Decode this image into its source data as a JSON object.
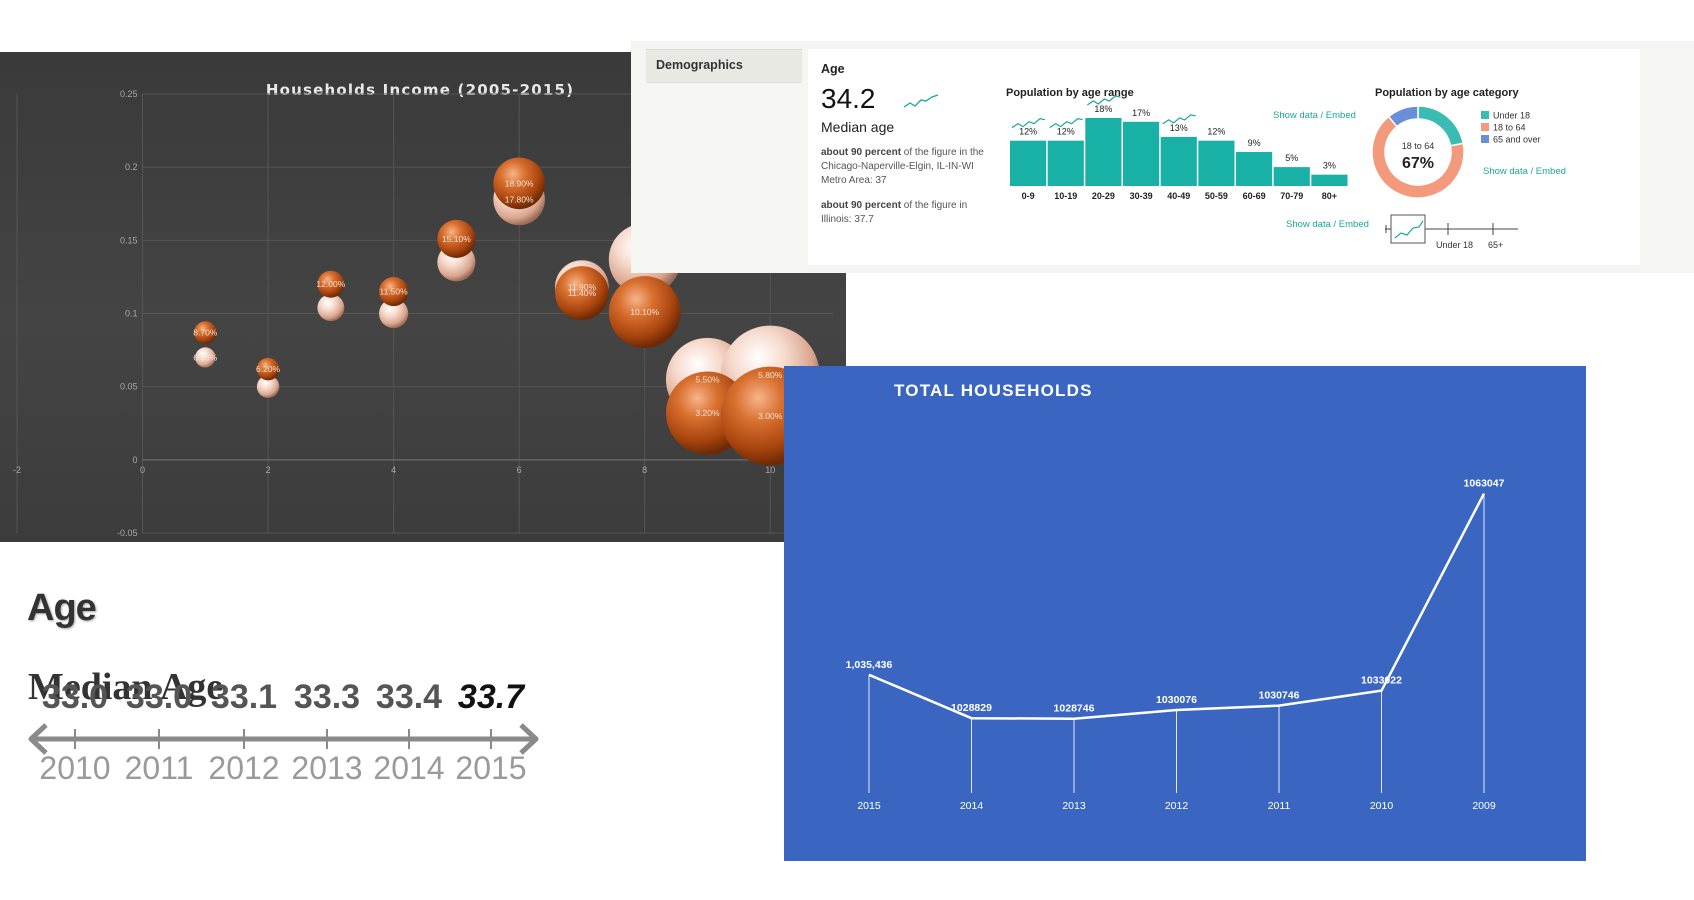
{
  "chart_data": [
    {
      "type": "scatter",
      "subtype": "bubble",
      "title": "Households Income (2005-2015)",
      "xlim": [
        -2,
        11
      ],
      "ylim": [
        -0.05,
        0.25
      ],
      "xticks": [
        "-2",
        "0",
        "2",
        "4",
        "6",
        "8",
        "10"
      ],
      "yticks": [
        "-0.05",
        "0",
        "0.05",
        "0.1",
        "0.15",
        "0.2",
        "0.25"
      ],
      "grid": true,
      "colors": {
        "dark_bubble": "#c2561b",
        "light_bubble": "#f0c8b6",
        "background": "#404040"
      },
      "series": [
        {
          "points": [
            {
              "x": 1,
              "y": 0.087,
              "size": 1.0,
              "label": "8.70%"
            },
            {
              "x": 2,
              "y": 0.062,
              "size": 1.0,
              "label": "6.20%"
            },
            {
              "x": 3,
              "y": 0.12,
              "size": 1.2,
              "label": "12.00%"
            },
            {
              "x": 4,
              "y": 0.115,
              "size": 1.3,
              "label": "11.50%"
            },
            {
              "x": 5,
              "y": 0.151,
              "size": 1.7,
              "label": "15.10%"
            },
            {
              "x": 6,
              "y": 0.189,
              "size": 2.3,
              "label": "18.90%"
            },
            {
              "x": 7,
              "y": 0.114,
              "size": 2.4,
              "label": "11.40%"
            },
            {
              "x": 8,
              "y": 0.101,
              "size": 3.2,
              "label": "10.10%"
            },
            {
              "x": 9,
              "y": 0.032,
              "size": 3.7,
              "label": "3.20%"
            },
            {
              "x": 10,
              "y": 0.03,
              "size": 4.4,
              "label": "3.00%"
            }
          ]
        },
        {
          "points": [
            {
              "x": 1,
              "y": 0.07,
              "size": 0.9,
              "label": "6.90%"
            },
            {
              "x": 2,
              "y": 0.05,
              "size": 1.0,
              "label": ""
            },
            {
              "x": 3,
              "y": 0.104,
              "size": 1.2,
              "label": ""
            },
            {
              "x": 4,
              "y": 0.1,
              "size": 1.3,
              "label": ""
            },
            {
              "x": 5,
              "y": 0.135,
              "size": 1.7,
              "label": ""
            },
            {
              "x": 6,
              "y": 0.178,
              "size": 2.3,
              "label": "17.80%"
            },
            {
              "x": 7,
              "y": 0.118,
              "size": 2.4,
              "label": "11.90%"
            },
            {
              "x": 8,
              "y": 0.137,
              "size": 3.2,
              "label": "13.70%"
            },
            {
              "x": 9,
              "y": 0.055,
              "size": 3.7,
              "label": "5.50%"
            },
            {
              "x": 10,
              "y": 0.058,
              "size": 4.4,
              "label": "5.80%"
            }
          ]
        }
      ]
    },
    {
      "type": "bar",
      "title": "Population by age range",
      "categories": [
        "0-9",
        "10-19",
        "20-29",
        "30-39",
        "40-49",
        "50-59",
        "60-69",
        "70-79",
        "80+"
      ],
      "values": [
        12,
        12,
        18,
        17,
        13,
        12,
        9,
        5,
        3
      ],
      "value_labels": [
        "12%",
        "12%",
        "18%",
        "17%",
        "13%",
        "12%",
        "9%",
        "5%",
        "3%"
      ],
      "color": "#19b0a6",
      "sparkline_categories": [
        "0-9",
        "10-19",
        "20-29",
        "40-49"
      ]
    },
    {
      "type": "pie",
      "subtype": "donut",
      "title": "Population by age category",
      "center_label": "18 to 64",
      "center_value": "67%",
      "slices": [
        {
          "name": "Under 18",
          "value": 22,
          "color": "#3bbcb2"
        },
        {
          "name": "18 to 64",
          "value": 67,
          "color": "#f29a7b"
        },
        {
          "name": "65 and over",
          "value": 11,
          "color": "#6b8fd6"
        }
      ],
      "legend_position": "right"
    },
    {
      "type": "line",
      "title": "TOTAL HOUSEHOLDS",
      "categories": [
        "2015",
        "2014",
        "2013",
        "2012",
        "2011",
        "2010",
        "2009"
      ],
      "values": [
        1035436,
        1028829,
        1028746,
        1030076,
        1030746,
        1033022,
        1063047
      ],
      "value_labels": [
        "1,035,436",
        "1028829",
        "1028746",
        "1030076",
        "1030746",
        "1033022",
        "1063047"
      ],
      "ylim": [
        1015000,
        1068000
      ],
      "colors": {
        "background": "#3a66c2",
        "line": "#ffffff"
      }
    },
    {
      "type": "line",
      "subtype": "timeline",
      "title": "Median Age",
      "categories": [
        "2010",
        "2011",
        "2012",
        "2013",
        "2014",
        "2015"
      ],
      "values": [
        33.0,
        33.0,
        33.1,
        33.3,
        33.4,
        33.7
      ],
      "value_labels": [
        "33.0",
        "33.0",
        "33.1",
        "33.3",
        "33.4",
        "33.7"
      ]
    }
  ],
  "demographics": {
    "sidebar_label": "Demographics",
    "section_title": "Age",
    "median_value": "34.2",
    "median_label": "Median age",
    "comparison_1_bold": "about 90 percent",
    "comparison_1_line1": " of the figure in the",
    "comparison_1_line2": "Chicago-Naperville-Elgin, IL-IN-WI",
    "comparison_1_line3": "Metro Area: 37",
    "comparison_2_bold": "about 90 percent",
    "comparison_2_line1": " of the figure in",
    "comparison_2_line2": "Illinois: 37.7",
    "show_data_label": "Show data / Embed",
    "slider_labels": [
      "Under 18",
      "65+"
    ]
  },
  "age_panel": {
    "heading": "Age"
  }
}
